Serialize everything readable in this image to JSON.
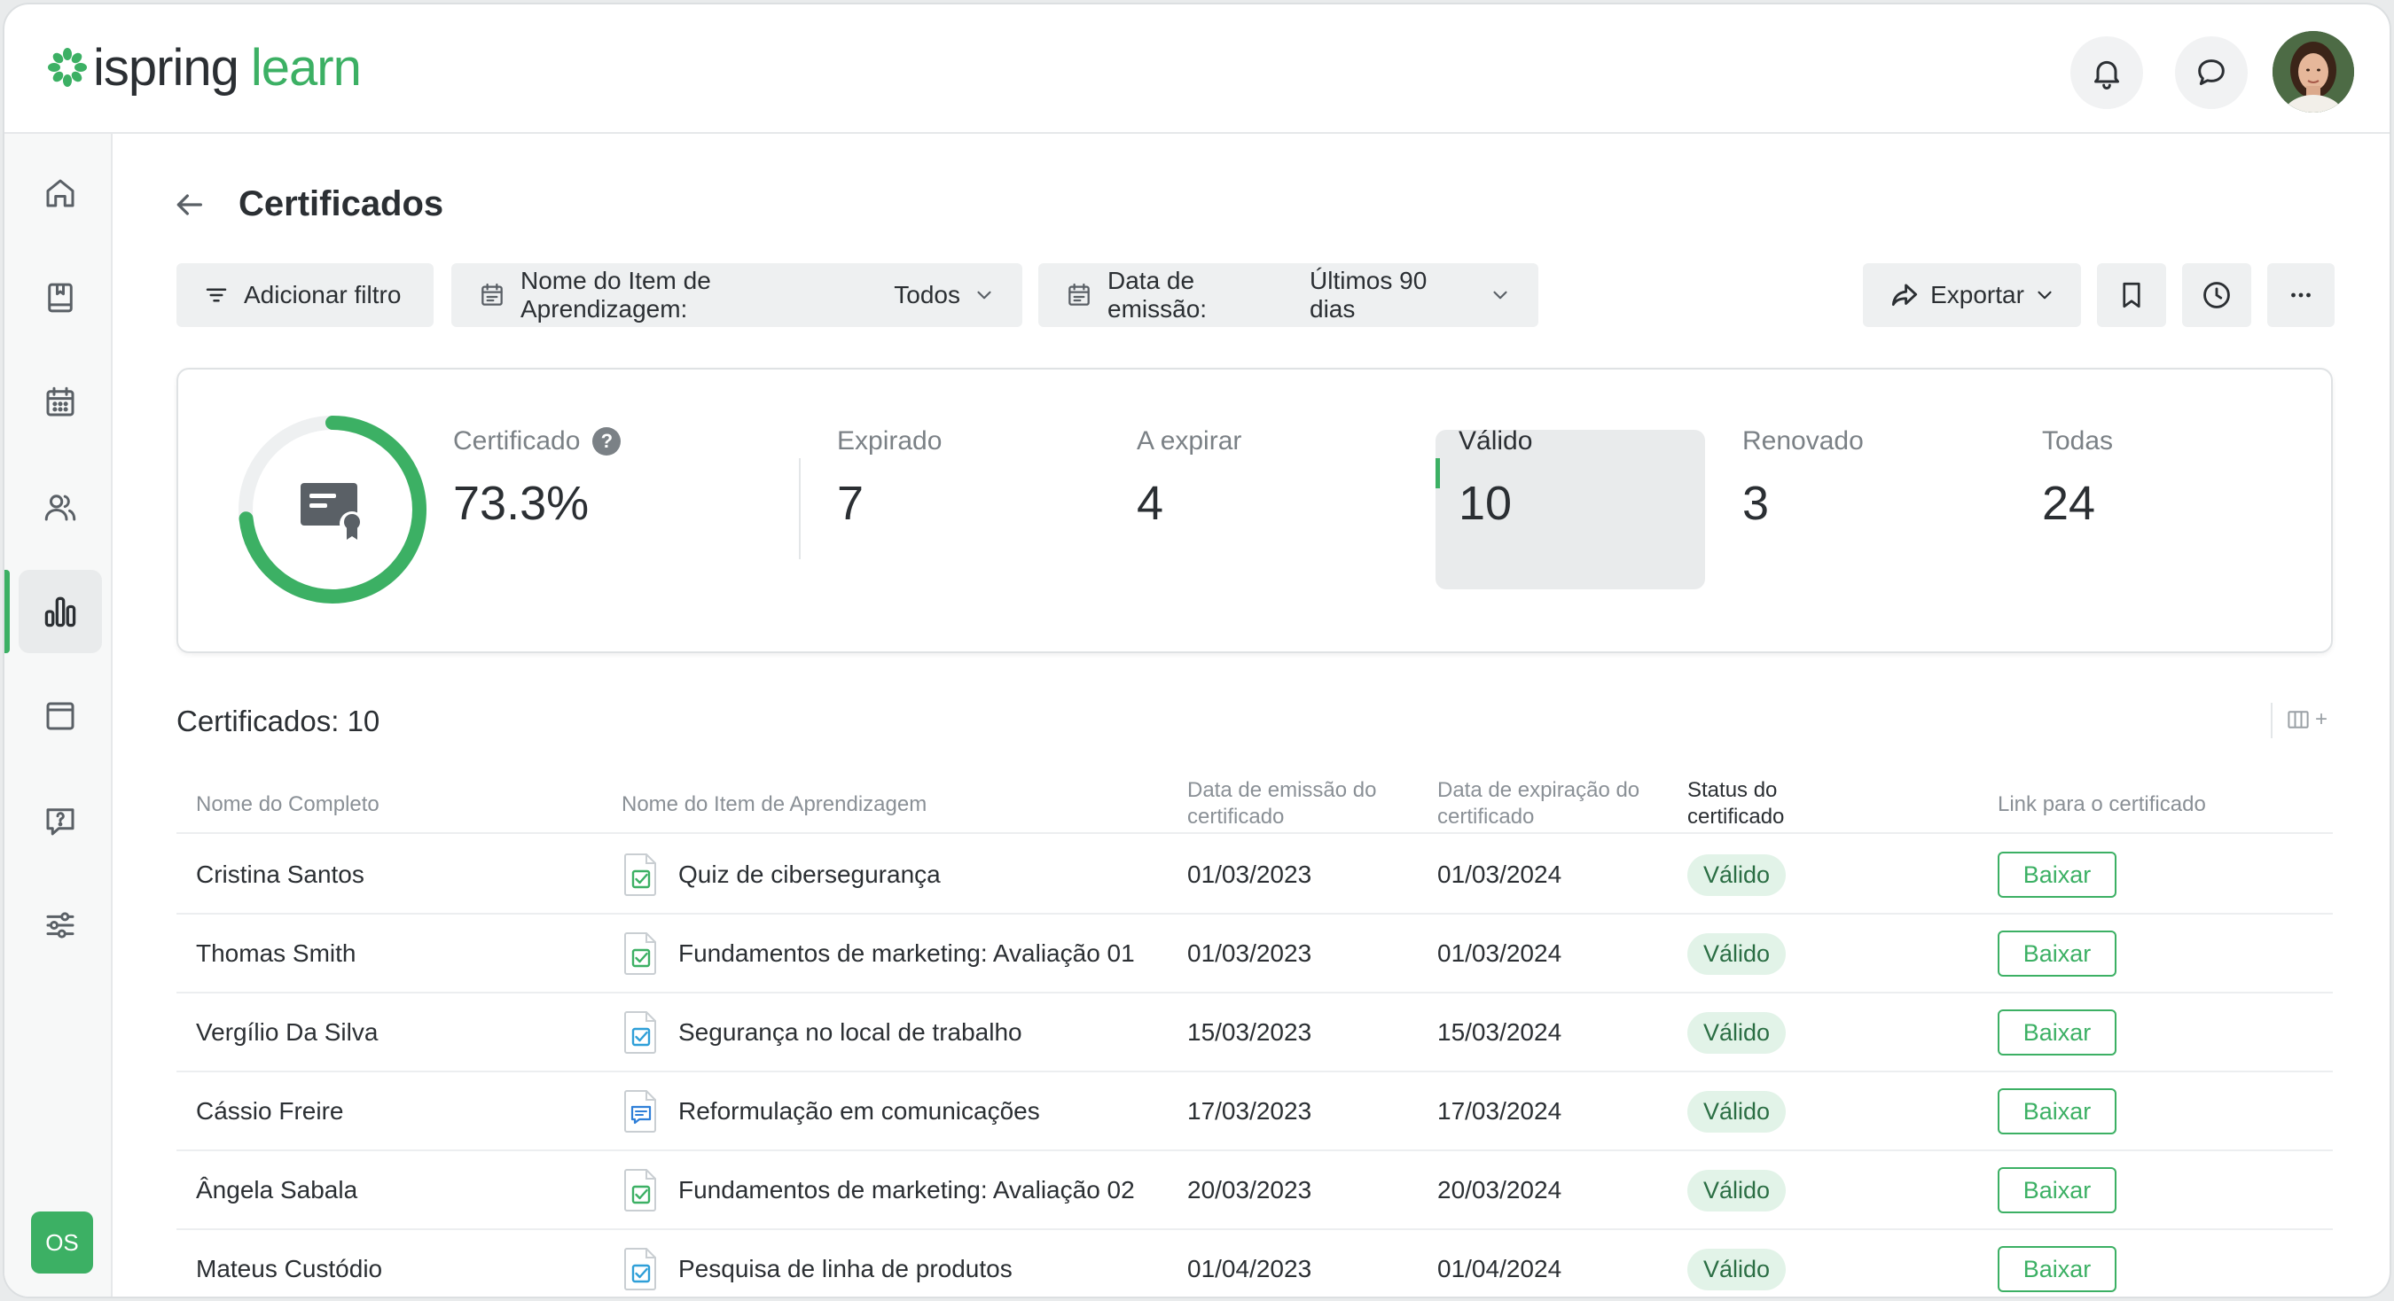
{
  "app": {
    "logo_part1": "ispring",
    "logo_part2": "learn",
    "brand_color": "#3cb064"
  },
  "header": {
    "notifications_icon": "bell-icon",
    "messages_icon": "chat-bubble-icon",
    "avatar": "user-avatar"
  },
  "sidebar": {
    "items": [
      {
        "name": "home",
        "icon": "home-icon",
        "active": false
      },
      {
        "name": "catalog",
        "icon": "book-icon",
        "active": false
      },
      {
        "name": "calendar",
        "icon": "calendar-icon",
        "active": false
      },
      {
        "name": "users",
        "icon": "users-icon",
        "active": false
      },
      {
        "name": "reports",
        "icon": "bar-chart-icon",
        "active": true
      },
      {
        "name": "content",
        "icon": "window-icon",
        "active": false
      },
      {
        "name": "questions",
        "icon": "question-bubble-icon",
        "active": false
      },
      {
        "name": "settings",
        "icon": "sliders-icon",
        "active": false
      }
    ],
    "user_initials": "OS"
  },
  "page": {
    "title": "Certificados"
  },
  "filters": {
    "add_filter": "Adicionar filtro",
    "learning_item_label": "Nome do Item de Aprendizagem:",
    "learning_item_value": "Todos",
    "issue_date_label": "Data de emissão:",
    "issue_date_value": "Últimos 90 dias",
    "export": "Exportar"
  },
  "stats": {
    "certified_label": "Certificado",
    "certified_value": "73.3%",
    "certified_fraction": 0.733,
    "help_mark": "?",
    "expired_label": "Expirado",
    "expired_value": "7",
    "expiring_label": "A expirar",
    "expiring_value": "4",
    "valid_label": "Válido",
    "valid_value": "10",
    "renewed_label": "Renovado",
    "renewed_value": "3",
    "all_label": "Todas",
    "all_value": "24"
  },
  "table": {
    "count_title": "Certificados: 10",
    "columns_add": "+",
    "headers": {
      "name": "Nome do Completo",
      "item": "Nome do Item de Aprendizagem",
      "issue_1": "Data de emissão do",
      "issue_2": "certificado",
      "expiry_1": "Data de expiração do",
      "expiry_2": "certificado",
      "status_1": "Status do",
      "status_2": "certificado",
      "link": "Link para o certificado"
    },
    "rows": [
      {
        "name": "Cristina Santos",
        "item": "Quiz de cibersegurança",
        "item_icon": "quiz-doc-icon",
        "issue": "01/03/2023",
        "expiry": "01/03/2024",
        "status": "Válido",
        "link": "Baixar"
      },
      {
        "name": "Thomas Smith",
        "item": "Fundamentos de marketing: Avaliação 01",
        "item_icon": "quiz-doc-icon",
        "issue": "01/03/2023",
        "expiry": "01/03/2024",
        "status": "Válido",
        "link": "Baixar"
      },
      {
        "name": "Vergílio Da Silva",
        "item": "Segurança no local de trabalho",
        "item_icon": "quiz-doc-icon",
        "issue": "15/03/2023",
        "expiry": "15/03/2024",
        "status": "Válido",
        "link": "Baixar"
      },
      {
        "name": "Cássio Freire",
        "item": "Reformulação em comunicações",
        "item_icon": "chat-doc-icon",
        "issue": "17/03/2023",
        "expiry": "17/03/2024",
        "status": "Válido",
        "link": "Baixar"
      },
      {
        "name": "Ângela Sabala",
        "item": "Fundamentos de marketing: Avaliação 02",
        "item_icon": "quiz-doc-icon",
        "issue": "20/03/2023",
        "expiry": "20/03/2024",
        "status": "Válido",
        "link": "Baixar"
      },
      {
        "name": "Mateus Custódio",
        "item": "Pesquisa de linha de produtos",
        "item_icon": "quiz-doc-icon",
        "issue": "01/04/2023",
        "expiry": "01/04/2024",
        "status": "Válido",
        "link": "Baixar"
      }
    ]
  }
}
